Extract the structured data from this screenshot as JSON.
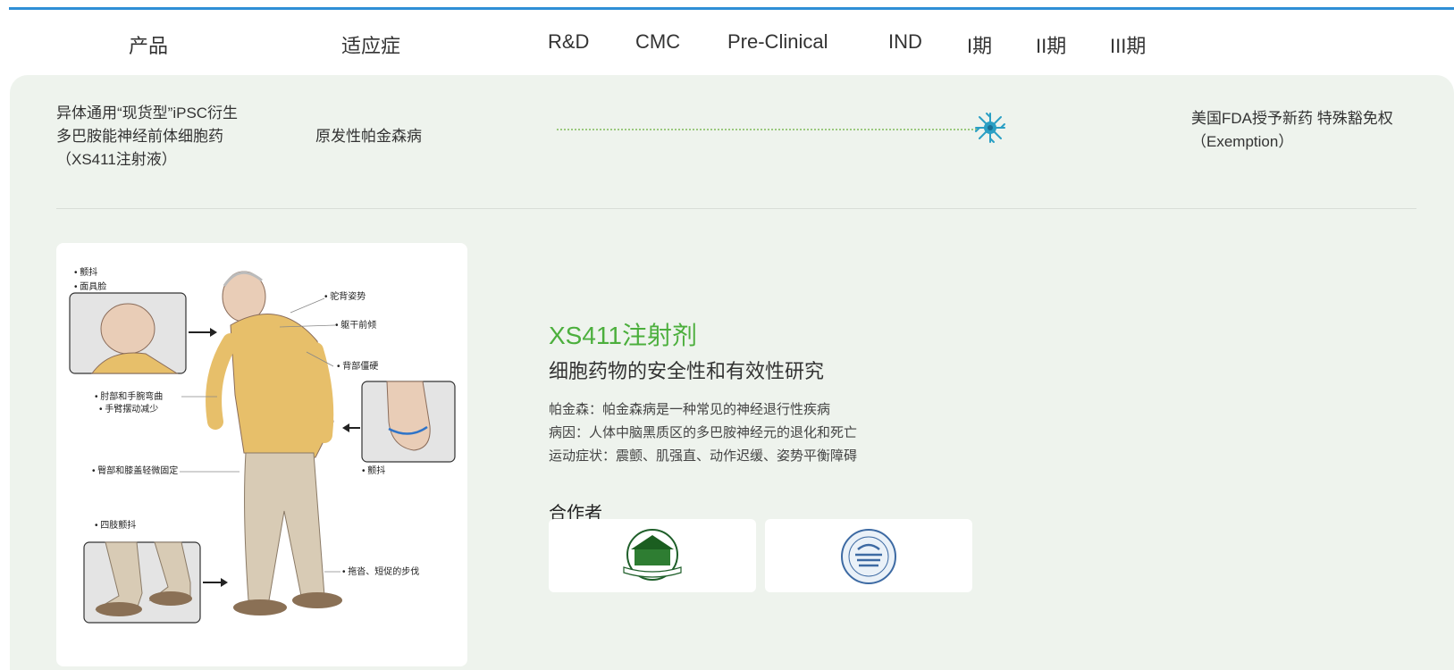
{
  "header": {
    "product": "产品",
    "indication": "适应症",
    "stages": [
      "R&D",
      "CMC",
      "Pre-Clinical",
      "IND",
      "I期",
      "II期",
      "III期"
    ]
  },
  "pipeline": {
    "product_name": "异体通用“现货型”iPSC衍生多巴胺能神经前体细胞药（XS411注射液）",
    "indication": "原发性帕金森病",
    "progress_stage": "I期",
    "status": "美国FDA授予新药 特殊豁免权（Exemption）"
  },
  "illustration": {
    "labels": {
      "tremor_top": "• 颤抖",
      "mask_face": "• 面具脸",
      "hunched": "• 驼背姿势",
      "trunk_forward": "• 躯干前倾",
      "back_stiff": "• 背部僵硬",
      "elbow_wrist": "• 肘部和手腕弯曲",
      "arm_swing": "• 手臂摆动减少",
      "tremor_hand": "• 颤抖",
      "hip_knee": "• 臀部和膝盖轻微固定",
      "limb_tremor": "• 四肢颤抖",
      "shuffle": "• 拖沓、短促的步伐"
    }
  },
  "info": {
    "title": "XS411注射剂",
    "subtitle": "细胞药物的安全性和有效性研究",
    "lines": [
      "帕金森：帕金森病是一种常见的神经退行性疾病",
      "病因：人体中脑黑质区的多巴胺神经元的退化和死亡",
      "运动症状：震颤、肌强直、动作迟缓、姿势平衡障碍"
    ],
    "partners_label": "合作者"
  },
  "colors": {
    "accent_green": "#4caf3d",
    "top_bar": "#2f8fd6",
    "panel_bg": "#eef3ed"
  }
}
